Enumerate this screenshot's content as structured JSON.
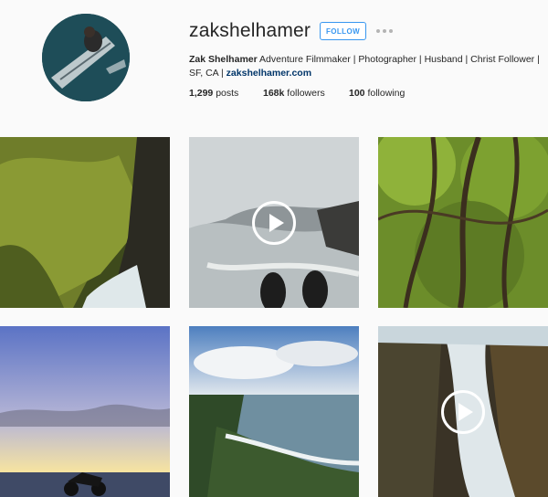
{
  "profile": {
    "username": "zakshelhamer",
    "follow_label": "FOLLOW",
    "bio_name": "Zak Shelhamer",
    "bio_line1": " Adventure Filmmaker | Photographer | Husband | Christ Follower |",
    "bio_line2": "SF, CA | ",
    "bio_link": "zakshelhamer.com",
    "posts_count": "1,299",
    "posts_label": " posts",
    "followers_count": "168k",
    "followers_label": " followers",
    "following_count": "100",
    "following_label": " following"
  },
  "colors": {
    "accent": "#3897f0",
    "link": "#003569",
    "background": "#fafafa"
  },
  "icons": {
    "more": "more-options-icon",
    "play": "play-icon"
  },
  "posts": [
    {
      "subject": "mossy-cliff",
      "video": false
    },
    {
      "subject": "ocean-wave-feet",
      "video": true
    },
    {
      "subject": "jungle-trees",
      "video": false
    },
    {
      "subject": "motorcycle-sunset",
      "video": false
    },
    {
      "subject": "coastline",
      "video": false
    },
    {
      "subject": "waterfall-canyon",
      "video": true
    }
  ]
}
